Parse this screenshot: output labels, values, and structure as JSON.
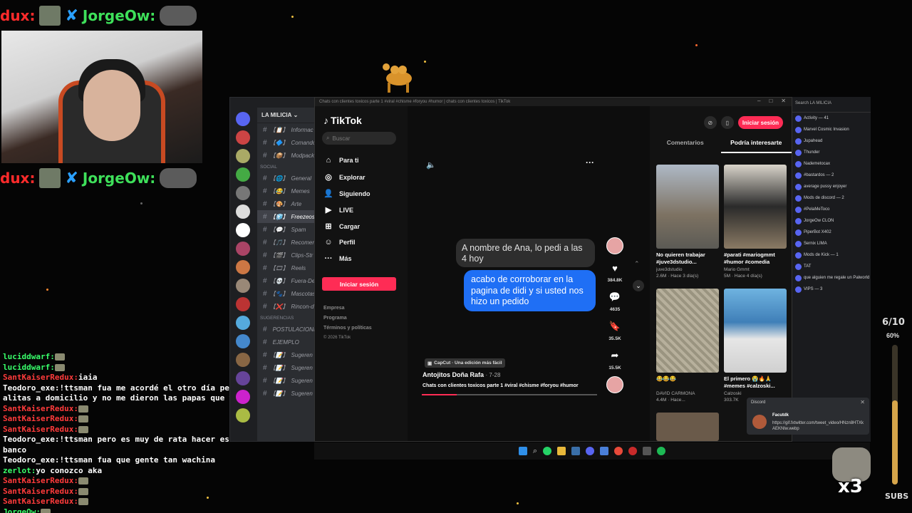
{
  "overlay": {
    "top_name_1": "dux:",
    "top_name_2": "JorgeOw:",
    "mid_name_1": "dux:",
    "mid_name_2": "JorgeOw:"
  },
  "chat_log": [
    {
      "user": "luciddwarf:",
      "msg": "",
      "user_color": "green"
    },
    {
      "user": "luciddwarf:",
      "msg": "",
      "user_color": "green"
    },
    {
      "user": "SantKaiserRedux:",
      "msg": "iaia",
      "user_color": "red"
    },
    {
      "user": "Teodoro_exe:",
      "msg": "!ttsman fua me acordé el otro día pedí unas",
      "user_color": "white"
    },
    {
      "user": "",
      "msg": "alitas a domicilio y no me dieron las papas que wachines",
      "user_color": "white"
    },
    {
      "user": "SantKaiserRedux:",
      "msg": "",
      "user_color": "red"
    },
    {
      "user": "SantKaiserRedux:",
      "msg": "",
      "user_color": "red"
    },
    {
      "user": "SantKaiserRedux:",
      "msg": "",
      "user_color": "red"
    },
    {
      "user": "Teodoro_exe:",
      "msg": "!ttsman pero es muy de rata hacer eso no",
      "user_color": "white"
    },
    {
      "user": "",
      "msg": "banco",
      "user_color": "white"
    },
    {
      "user": "Teodoro_exe:",
      "msg": "!ttsman fua que gente tan wachina",
      "user_color": "white"
    },
    {
      "user": "zerlot:",
      "msg": "yo conozco aka",
      "user_color": "green"
    },
    {
      "user": "SantKaiserRedux:",
      "msg": "",
      "user_color": "red"
    },
    {
      "user": "SantKaiserRedux:",
      "msg": "",
      "user_color": "red"
    },
    {
      "user": "SantKaiserRedux:",
      "msg": "",
      "user_color": "red"
    },
    {
      "user": "JorgeOw:",
      "msg": "",
      "user_color": "green"
    }
  ],
  "discord": {
    "server_name": "LA MILICIA",
    "channels": [
      {
        "icon": "【📋】",
        "name": "Informac"
      },
      {
        "icon": "【🔷】",
        "name": "Comando"
      },
      {
        "icon": "【📦】",
        "name": "Modpack"
      },
      {
        "category": "SOCIAL"
      },
      {
        "icon": "【🌐】",
        "name": "General"
      },
      {
        "icon": "【😂】",
        "name": "Memes"
      },
      {
        "icon": "【🎨】",
        "name": "Arte"
      },
      {
        "icon": "【🧊】",
        "name": "Freezeos",
        "active": true
      },
      {
        "icon": "【💬】",
        "name": "Spam"
      },
      {
        "icon": "【🎵】",
        "name": "Recomen"
      },
      {
        "icon": "【🎬】",
        "name": "Clips-Str"
      },
      {
        "icon": "【🎞】",
        "name": "Reels"
      },
      {
        "icon": "【💀】",
        "name": "Fuera-De"
      },
      {
        "icon": "【🐾】",
        "name": "Mascotas"
      },
      {
        "icon": "【❌】",
        "name": "Rincon-d"
      },
      {
        "category": "SUGERENCIAS"
      },
      {
        "icon": "",
        "name": "POSTULACIONE"
      },
      {
        "icon": "",
        "name": "EJEMPLO"
      },
      {
        "icon": "【📝】",
        "name": "Sugeren"
      },
      {
        "icon": "【📝】",
        "name": "Sugeren"
      },
      {
        "icon": "【📝】",
        "name": "Sugeren"
      },
      {
        "icon": "【📝】",
        "name": "Sugeren"
      }
    ],
    "user_name": "Pelo"
  },
  "tiktok": {
    "title_bar": "Chats con clientes toxicos parte 1 #viral #chisme #foryou #humor | chats con clientes toxicos | TikTok",
    "logo": "TikTok",
    "search_placeholder": "Buscar",
    "nav": [
      "Para ti",
      "Explorar",
      "Siguiendo",
      "LIVE",
      "Cargar",
      "Perfil",
      "Más"
    ],
    "login_button": "Iniciar sesión",
    "footer": [
      "Empresa",
      "Programa",
      "Términos y políticas",
      "© 2026 TikTok"
    ],
    "bubble_grey": "A nombre de Ana, lo pedi a las 4 hoy",
    "bubble_blue": "acabo de corroborar en la pagina de didi y si usted nos hizo un pedido",
    "likes": "384.8K",
    "comments": "4635",
    "saves": "35.5K",
    "shares": "15.5K",
    "capcut": "CapCut · Una edición más fácil",
    "author": "Antojitos Doña Rafa",
    "date": "7-28",
    "description": "Chats con clientes toxicos parte 1 #viral #chisme #foryou #humor",
    "progress": 0.2,
    "top_login": "Iniciar sesión",
    "tabs": [
      "Comentarios",
      "Podría interesarte"
    ],
    "cards": [
      {
        "title": "No quieren trabajar #juve3dstudio...",
        "meta": "juve3dstudio",
        "meta2": "2.6M · Hace 3 día(s)"
      },
      {
        "title": "#parati #mariogmmt #humor #comedia",
        "meta": "Mario Gmmt",
        "meta2": "5M · Hace 4 día(s)"
      },
      {
        "title": "😂😂😂",
        "meta": "DAVID CARMONA",
        "meta2": "4.4M · Hace..."
      },
      {
        "title": "El primero 😭🔥🙏 #memes #calzoski...",
        "meta": "Calzoski",
        "meta2": "303.7K"
      }
    ]
  },
  "right_list": {
    "search": "Search LA MILICIA",
    "items": [
      "Activity — 41",
      "Marvel Cosmic Invasion",
      "Jupahead",
      "Thunder",
      "Nademetocax",
      "#bastardos — 2",
      "average pussy enjoyer",
      "Mods de discord — 2",
      "#PelaMeToco",
      "JorgeOw CLON",
      "PiperBot X402",
      "Sernix LIMA",
      "Mods de Kick — 1",
      "TAT",
      "que alguien me regale un Palworld",
      "VIPS — 3"
    ]
  },
  "notification": {
    "app": "Discord",
    "user": "Facutdk",
    "text": "https://gif.fxtwitter.com/tweet_video/HNzn8HTXkAEKNlw.webp"
  },
  "subs_goal": {
    "count": "6/10",
    "percent": "60%",
    "label": "SUBS",
    "multiplier": "x3",
    "fraction": 0.6
  }
}
